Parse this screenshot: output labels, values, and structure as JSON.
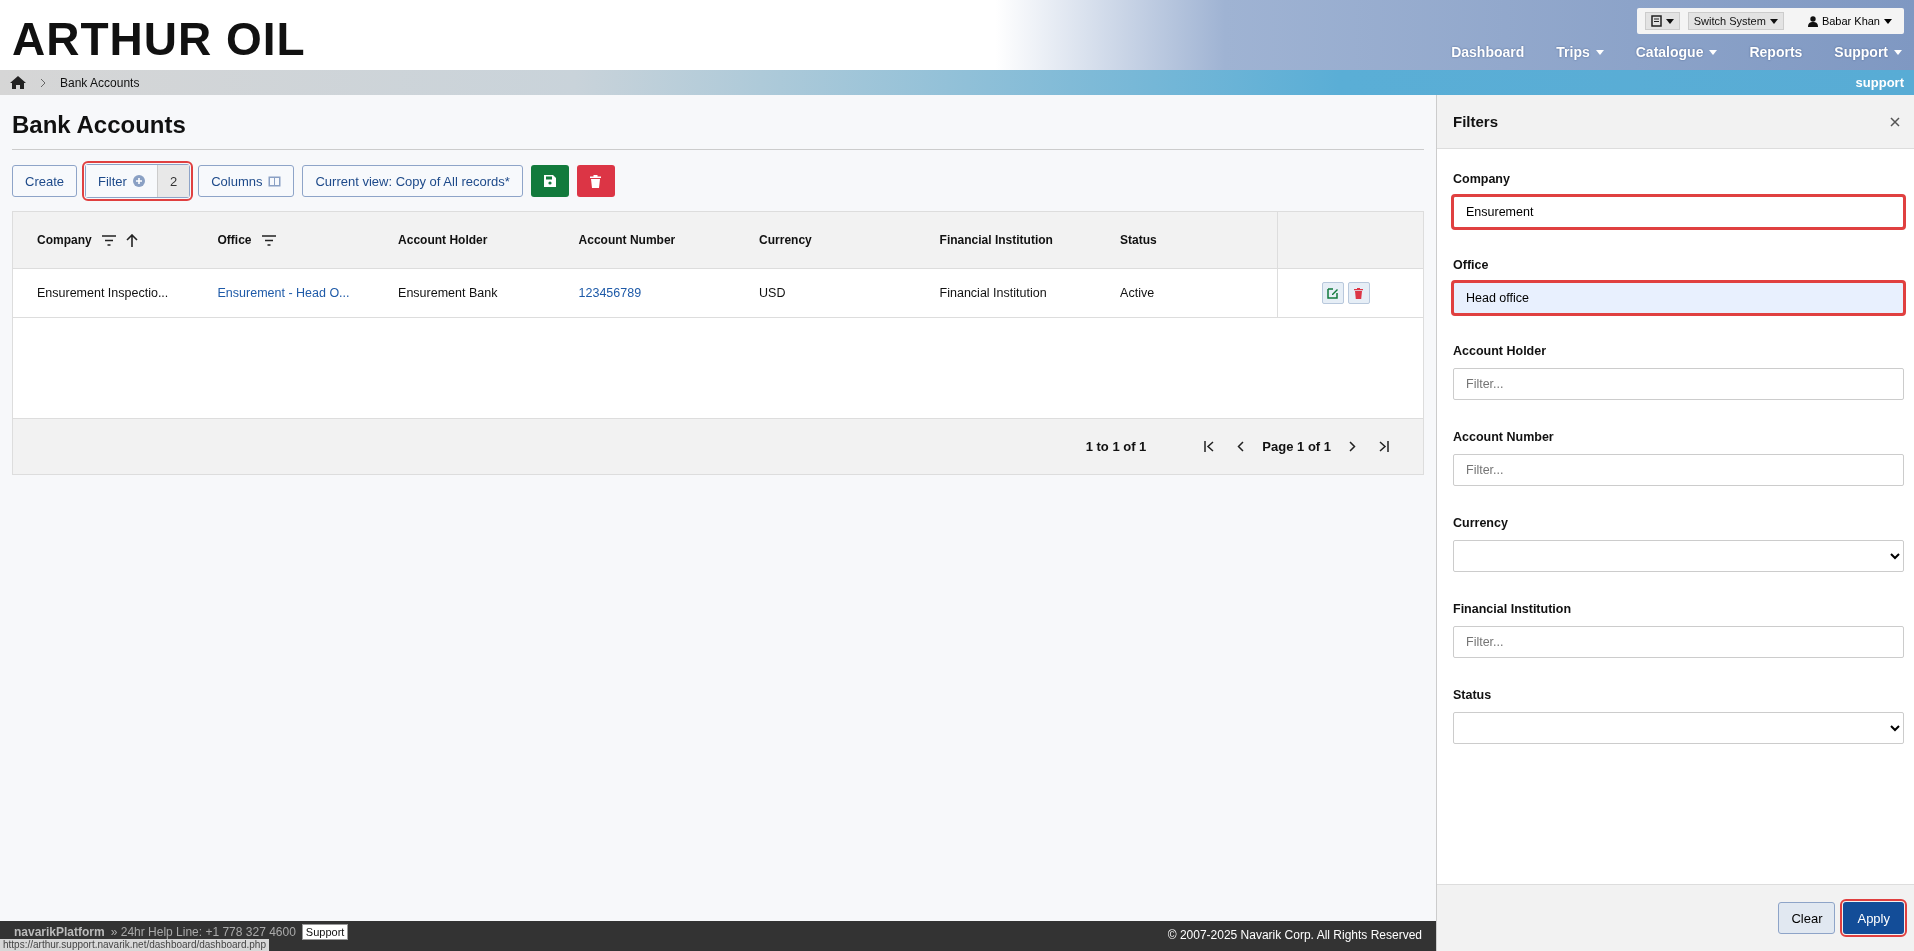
{
  "header": {
    "logo": "ARTHUR OIL",
    "user": "Babar Khan",
    "switch_system": "Switch System",
    "nav": [
      {
        "label": "Dashboard",
        "dropdown": false
      },
      {
        "label": "Trips",
        "dropdown": true
      },
      {
        "label": "Catalogue",
        "dropdown": true
      },
      {
        "label": "Reports",
        "dropdown": false
      },
      {
        "label": "Support",
        "dropdown": true
      }
    ]
  },
  "breadcrumb": {
    "items": [
      "Bank Accounts"
    ],
    "tag": "support"
  },
  "page": {
    "title": "Bank Accounts",
    "toolbar": {
      "create": "Create",
      "filter": "Filter",
      "filter_count": "2",
      "filter_highlighted": true,
      "columns": "Columns",
      "view": "Current view: Copy of All records*"
    },
    "table": {
      "columns": [
        {
          "label": "Company",
          "filter": true,
          "sorted": true
        },
        {
          "label": "Office",
          "filter": true,
          "sorted": false
        },
        {
          "label": "Account Holder",
          "filter": false,
          "sorted": false
        },
        {
          "label": "Account Number",
          "filter": false,
          "sorted": false
        },
        {
          "label": "Currency",
          "filter": false,
          "sorted": false
        },
        {
          "label": "Financial Institution",
          "filter": false,
          "sorted": false
        },
        {
          "label": "Status",
          "filter": false,
          "sorted": false
        }
      ],
      "rows": [
        {
          "cells": [
            {
              "text": "Ensurement Inspectio...",
              "link": false
            },
            {
              "text": "Ensurement - Head O...",
              "link": true
            },
            {
              "text": "Ensurement Bank",
              "link": false
            },
            {
              "text": "123456789",
              "link": true
            },
            {
              "text": "USD",
              "link": false
            },
            {
              "text": "Financial Institution",
              "link": false
            },
            {
              "text": "Active",
              "link": false
            }
          ]
        }
      ],
      "range": "1 to 1 of 1",
      "page": "Page 1 of 1"
    }
  },
  "filters": {
    "title": "Filters",
    "fields": [
      {
        "label": "Company",
        "kind": "text",
        "value": "Ensurement",
        "autofilled": false,
        "highlighted": true
      },
      {
        "label": "Office",
        "kind": "text",
        "value": "Head office",
        "autofilled": true,
        "highlighted": true
      },
      {
        "label": "Account Holder",
        "kind": "text",
        "placeholder": "Filter...",
        "autofilled": false,
        "highlighted": false
      },
      {
        "label": "Account Number",
        "kind": "text",
        "placeholder": "Filter...",
        "autofilled": false,
        "highlighted": false
      },
      {
        "label": "Currency",
        "kind": "select",
        "autofilled": false,
        "highlighted": false
      },
      {
        "label": "Financial Institution",
        "kind": "text",
        "placeholder": "Filter...",
        "autofilled": false,
        "highlighted": false
      },
      {
        "label": "Status",
        "kind": "select",
        "autofilled": false,
        "highlighted": false
      }
    ],
    "clear": "Clear",
    "apply": "Apply",
    "apply_highlighted": true
  },
  "footer": {
    "brand": "navarikPlatform",
    "help": "» 24hr Help Line: +1 778 327 4600",
    "support": "Support",
    "copyright": "© 2007-2025 Navarik Corp. All Rights Reserved",
    "status_url": "https://arthur.support.navarik.net/dashboard/dashboard.php"
  }
}
